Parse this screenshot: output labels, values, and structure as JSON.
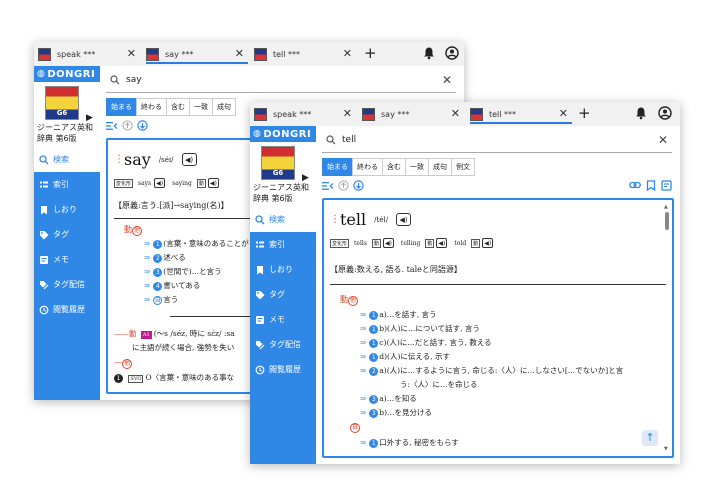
{
  "windows": [
    {
      "id": "back",
      "tabs": [
        {
          "label": "speak ***",
          "active": false
        },
        {
          "label": "say ***",
          "active": true
        },
        {
          "label": "tell ***",
          "active": false
        }
      ],
      "brand": "DONGRI",
      "book": {
        "publisher": "GENIUS",
        "edition": "G6",
        "title": "ジーニアス英和辞典 第6版"
      },
      "nav": [
        {
          "key": "search",
          "label": "検索",
          "icon": "search-icon",
          "active": true
        },
        {
          "key": "index",
          "label": "索引",
          "icon": "index-icon",
          "active": false
        },
        {
          "key": "bookmark",
          "label": "しおり",
          "icon": "bookmark-icon",
          "active": false
        },
        {
          "key": "tag",
          "label": "タグ",
          "icon": "tag-icon",
          "active": false
        },
        {
          "key": "memo",
          "label": "メモ",
          "icon": "memo-icon",
          "active": false
        },
        {
          "key": "tagdist",
          "label": "タグ配信",
          "icon": "tag-distribution-icon",
          "active": false
        },
        {
          "key": "history",
          "label": "閲覧履歴",
          "icon": "history-icon",
          "active": false
        }
      ],
      "search": {
        "value": "say"
      },
      "modes": [
        "始まる",
        "終わる",
        "含む",
        "一致",
        "成句"
      ],
      "entry": {
        "headword": "say",
        "pron": "/séɪ/",
        "infl_badge": "変化形",
        "inflections": [
          "says",
          "saying"
        ],
        "inflection_badge": "動",
        "etym": "【原義:言う.[派]→saying(名)】",
        "pos": "動",
        "pos_sub": "他",
        "senses": [
          {
            "num": "1",
            "text": "(言葉・意味のあることが"
          },
          {
            "num": "2",
            "text": "述べる"
          },
          {
            "num": "3",
            "text": "(世間で)…と言う"
          },
          {
            "num": "4",
            "text": "書いてある"
          },
          {
            "num": "自",
            "text": "言う"
          }
        ],
        "line_a": "(～s /séz, 時に sέz/ :sa",
        "line_a_badge": "A1",
        "line_b": "に主語が続く場合, 強勢を失い",
        "pos2": "他",
        "last_num": "1",
        "last_box": "SVO",
        "last_text": "O〈言葉・意味のある事な"
      }
    },
    {
      "id": "front",
      "tabs": [
        {
          "label": "speak ***",
          "active": false
        },
        {
          "label": "say ***",
          "active": false
        },
        {
          "label": "tell ***",
          "active": true
        }
      ],
      "brand": "DONGRI",
      "book": {
        "publisher": "GENIUS",
        "edition": "G6",
        "title": "ジーニアス英和辞典 第6版"
      },
      "nav": [
        {
          "key": "search",
          "label": "検索",
          "icon": "search-icon",
          "active": true
        },
        {
          "key": "index",
          "label": "索引",
          "icon": "index-icon",
          "active": false
        },
        {
          "key": "bookmark",
          "label": "しおり",
          "icon": "bookmark-icon",
          "active": false
        },
        {
          "key": "tag",
          "label": "タグ",
          "icon": "tag-icon",
          "active": false
        },
        {
          "key": "memo",
          "label": "メモ",
          "icon": "memo-icon",
          "active": false
        },
        {
          "key": "tagdist",
          "label": "タグ配信",
          "icon": "tag-distribution-icon",
          "active": false
        },
        {
          "key": "history",
          "label": "閲覧履歴",
          "icon": "history-icon",
          "active": false
        }
      ],
      "search": {
        "value": "tell"
      },
      "modes": [
        "始まる",
        "終わる",
        "含む",
        "一致",
        "成句",
        "例文"
      ],
      "entry": {
        "headword": "tell",
        "pron": "/tél/",
        "infl_badge": "変化形",
        "inflections": [
          "tells",
          "telling",
          "told"
        ],
        "inflection_badge": "動",
        "etym": "【原義:数える, 語る. taleと同語源】",
        "pos": "動",
        "pos_sub": "他",
        "senses": [
          {
            "num": "1",
            "suffix": "a",
            "text": "…を話す, 言う"
          },
          {
            "num": "1",
            "suffix": "b",
            "text": "(人)に…について話す, 言う"
          },
          {
            "num": "1",
            "suffix": "c",
            "text": "(人)に…だと話す, 言う, 教える"
          },
          {
            "num": "1",
            "suffix": "d",
            "text": "(人)に伝える, 示す"
          },
          {
            "num": "2",
            "suffix": "a",
            "text": "(人)に…するように言う, 命じる:〈人〉に…しなさい[…でないか]と言"
          },
          {
            "num": "",
            "suffix": "",
            "text": "う:〈人〉に…を命じる"
          },
          {
            "num": "3",
            "suffix": "a",
            "text": "…を知る"
          },
          {
            "num": "3",
            "suffix": "b",
            "text": "…を見分ける"
          }
        ],
        "pos2": "自",
        "senses2": [
          {
            "num": "1",
            "text": "口外する, 秘密をもらす"
          }
        ]
      }
    }
  ],
  "colors": {
    "accent": "#2f87e6",
    "pos": "#e0452a"
  }
}
